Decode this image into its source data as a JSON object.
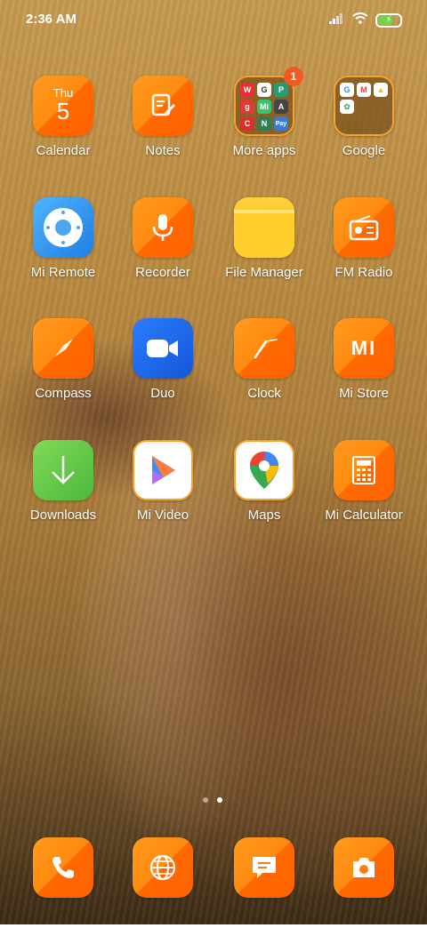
{
  "status_bar": {
    "time": "2:36 AM",
    "battery_charging": true
  },
  "apps": {
    "calendar": {
      "label": "Calendar",
      "day": "Thu",
      "date": "5"
    },
    "notes": {
      "label": "Notes"
    },
    "more_apps": {
      "label": "More apps",
      "badge": "1",
      "mini_icons": [
        "W",
        "G",
        "P",
        "g",
        "Mi",
        "A",
        "C",
        "N",
        "Pay"
      ]
    },
    "google": {
      "label": "Google",
      "mini_icons": [
        "G",
        "M",
        "▲",
        "✿"
      ]
    },
    "mi_remote": {
      "label": "Mi Remote"
    },
    "recorder": {
      "label": "Recorder"
    },
    "file_manager": {
      "label": "File Manager"
    },
    "fm_radio": {
      "label": "FM Radio"
    },
    "compass": {
      "label": "Compass"
    },
    "duo": {
      "label": "Duo"
    },
    "clock": {
      "label": "Clock"
    },
    "mi_store": {
      "label": "Mi Store",
      "logo_text": "MI"
    },
    "downloads": {
      "label": "Downloads"
    },
    "mi_video": {
      "label": "Mi Video"
    },
    "maps": {
      "label": "Maps"
    },
    "mi_calculator": {
      "label": "Mi Calculator"
    }
  },
  "page_indicator": {
    "pages": 2,
    "current": 2
  },
  "dock": [
    "phone",
    "browser",
    "messages",
    "camera"
  ],
  "colors": {
    "theme_orange": "#ff8a10",
    "badge": "#f25a22",
    "battery_fill": "#6fd64a"
  }
}
